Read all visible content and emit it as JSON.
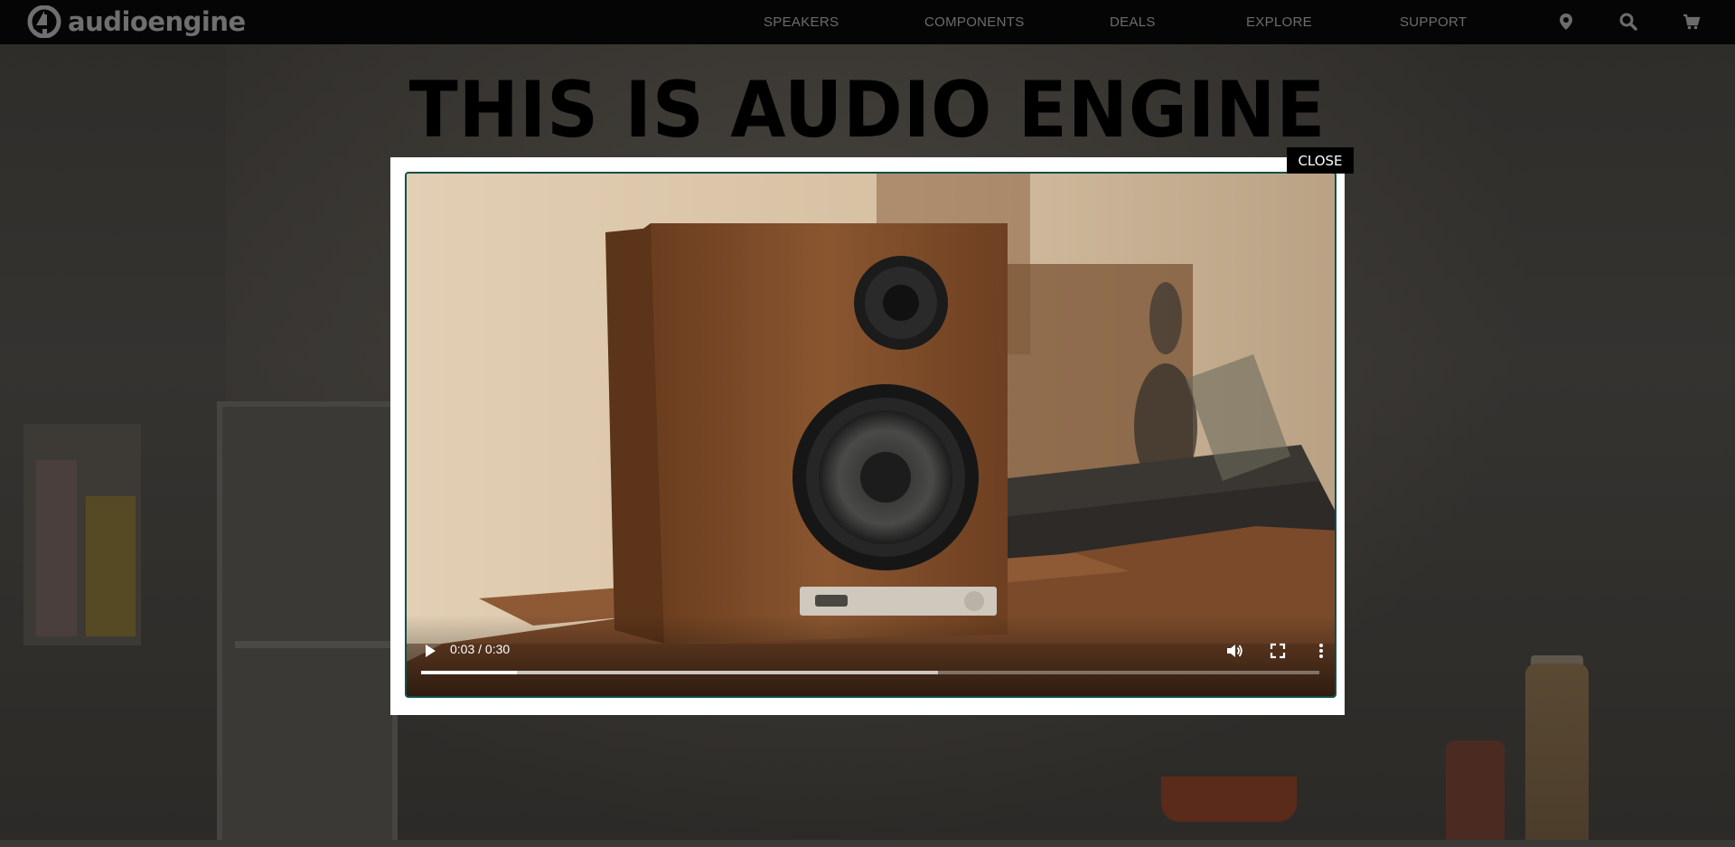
{
  "brand": {
    "name": "audioengine"
  },
  "nav": {
    "links": [
      "SPEAKERS",
      "COMPONENTS",
      "DEALS",
      "EXPLORE",
      "SUPPORT"
    ],
    "icons": [
      "location-pin-icon",
      "search-icon",
      "cart-icon"
    ]
  },
  "hero": {
    "headline": "THIS IS AUDIO ENGINE"
  },
  "modal": {
    "close_label": "CLOSE",
    "video": {
      "current_time": "0:03",
      "duration": "0:30",
      "time_display": "0:03 / 0:30",
      "played_fraction": 0.107,
      "buffered_fraction": 0.575,
      "icons": [
        "play-icon",
        "volume-icon",
        "fullscreen-icon",
        "more-options-icon"
      ]
    }
  },
  "colors": {
    "nav_bg": "#050505",
    "nav_text": "#6c6c6c",
    "modal_bg": "#ffffff",
    "video_border": "#0f4f4a",
    "overlay": "#2b2a28"
  }
}
